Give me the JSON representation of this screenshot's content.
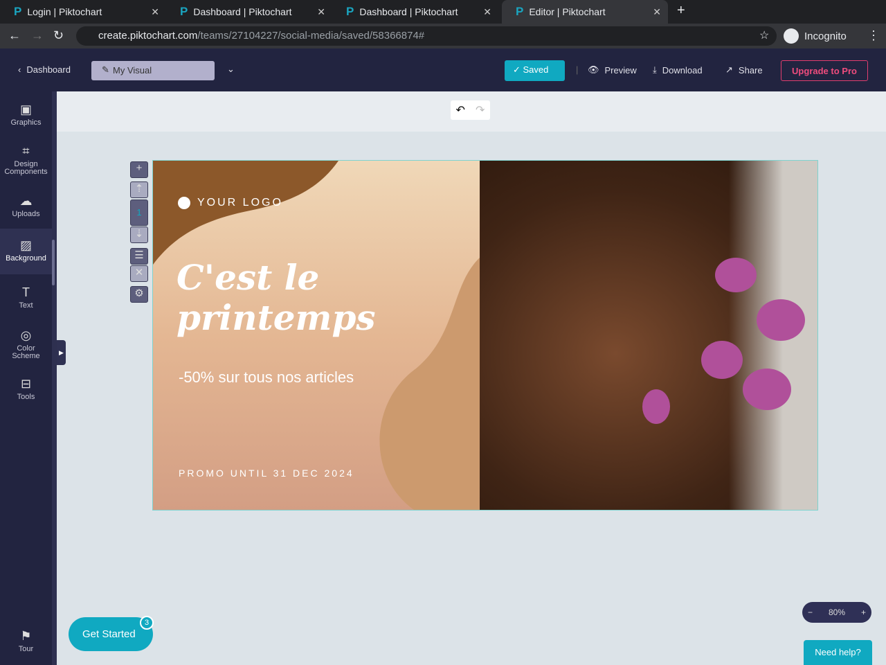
{
  "browser": {
    "tabs": [
      {
        "label": "Login | Piktochart"
      },
      {
        "label": "Dashboard | Piktochart"
      },
      {
        "label": "Dashboard | Piktochart"
      },
      {
        "label": "Editor | Piktochart"
      }
    ],
    "url_host": "create.piktochart.com",
    "url_path": "/teams/27104227/social-media/saved/58366874#",
    "profile": "Incognito"
  },
  "topbar": {
    "back": "Dashboard",
    "title": "My Visual",
    "saved": "Saved",
    "preview": "Preview",
    "download": "Download",
    "share": "Share",
    "upgrade": "Upgrade to Pro"
  },
  "sidebar": {
    "items": [
      {
        "label": "Graphics"
      },
      {
        "label": "Design Components"
      },
      {
        "label": "Uploads"
      },
      {
        "label": "Background"
      },
      {
        "label": "Text"
      },
      {
        "label": "Color Scheme"
      },
      {
        "label": "Tools"
      }
    ],
    "tour": "Tour"
  },
  "page_controls": {
    "page_number": "1"
  },
  "design": {
    "logo": "YOUR LOGO",
    "headline": "C'est le printemps",
    "subtitle": "-50% sur tous nos articles",
    "promo": "PROMO UNTIL 31 DEC 2024"
  },
  "zoom": {
    "value": "80%"
  },
  "get_started": {
    "label": "Get Started",
    "count": "3"
  },
  "help": "Need help?",
  "colors": {
    "accent": "#10a9c1",
    "nav": "#222440",
    "upgrade": "#ef4c7d"
  }
}
